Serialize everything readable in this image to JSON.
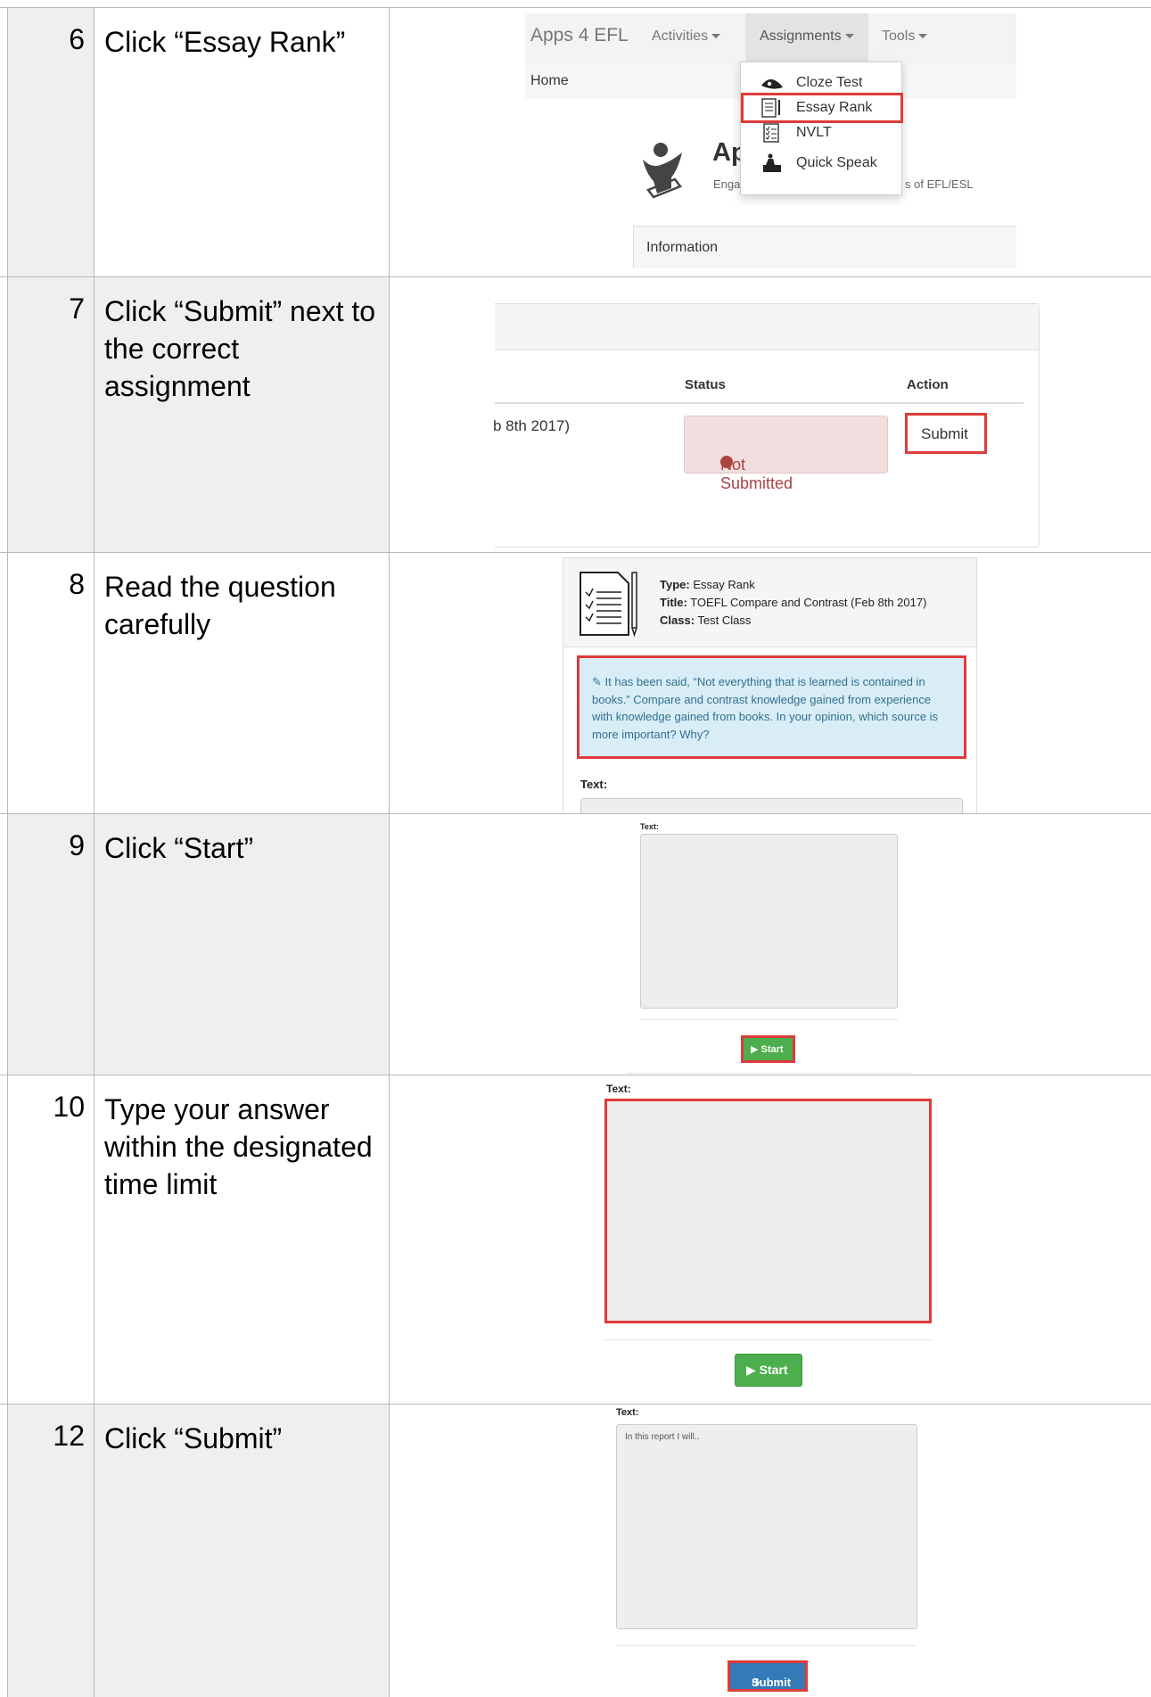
{
  "steps": [
    {
      "number": "6",
      "text": "Click “Essay Rank”"
    },
    {
      "number": "7",
      "text": "Click “Submit” next to the correct assignment"
    },
    {
      "number": "8",
      "text": "Read the question carefully"
    },
    {
      "number": "9",
      "text": "Click “Start”"
    },
    {
      "number": "10",
      "text": "Type your answer within the designated time limit"
    },
    {
      "number": "12",
      "text": "Click “Submit”"
    }
  ],
  "step6": {
    "brand": "Apps 4 EFL",
    "nav": {
      "activities": "Activities",
      "assignments": "Assignments",
      "tools": "Tools"
    },
    "home": "Home",
    "dropdown": [
      {
        "label": "Cloze Test",
        "icon": "eye-shape-icon"
      },
      {
        "label": "Essay Rank",
        "icon": "document-pencil-icon"
      },
      {
        "label": "NVLT",
        "icon": "checklist-icon"
      },
      {
        "label": "Quick Speak",
        "icon": "podium-icon"
      }
    ],
    "heading_fragment": "Ap",
    "tagline_left": "Enga",
    "tagline_right": "s of EFL/ESL",
    "information": "Information"
  },
  "step7": {
    "status_header": "Status",
    "action_header": "Action",
    "date_fragment": "b 8th 2017)",
    "status_value": "Not Submitted",
    "submit_label": "Submit"
  },
  "step8": {
    "type_label": "Type:",
    "type_value": "Essay Rank",
    "title_label": "Title:",
    "title_value": "TOEFL Compare and Contrast (Feb 8th 2017)",
    "class_label": "Class:",
    "class_value": "Test Class",
    "question": "It has been said, “Not everything that is learned is contained in books.” Compare and contrast knowledge gained from experience with knowledge gained from books. In your opinion, which source is more important? Why?",
    "text_label": "Text:"
  },
  "step9": {
    "text_label": "Text:",
    "start_label": "▶ Start"
  },
  "step10": {
    "text_label": "Text:",
    "start_label": "▶ Start"
  },
  "step12": {
    "text_label": "Text:",
    "textarea_value": "In this report I will..",
    "submit_label": "Submit"
  },
  "colors": {
    "highlight": "#e03a3a",
    "success": "#4cae4c",
    "primary": "#337ab7",
    "danger_bg": "#f2dede",
    "info_bg": "#d9edf7"
  }
}
